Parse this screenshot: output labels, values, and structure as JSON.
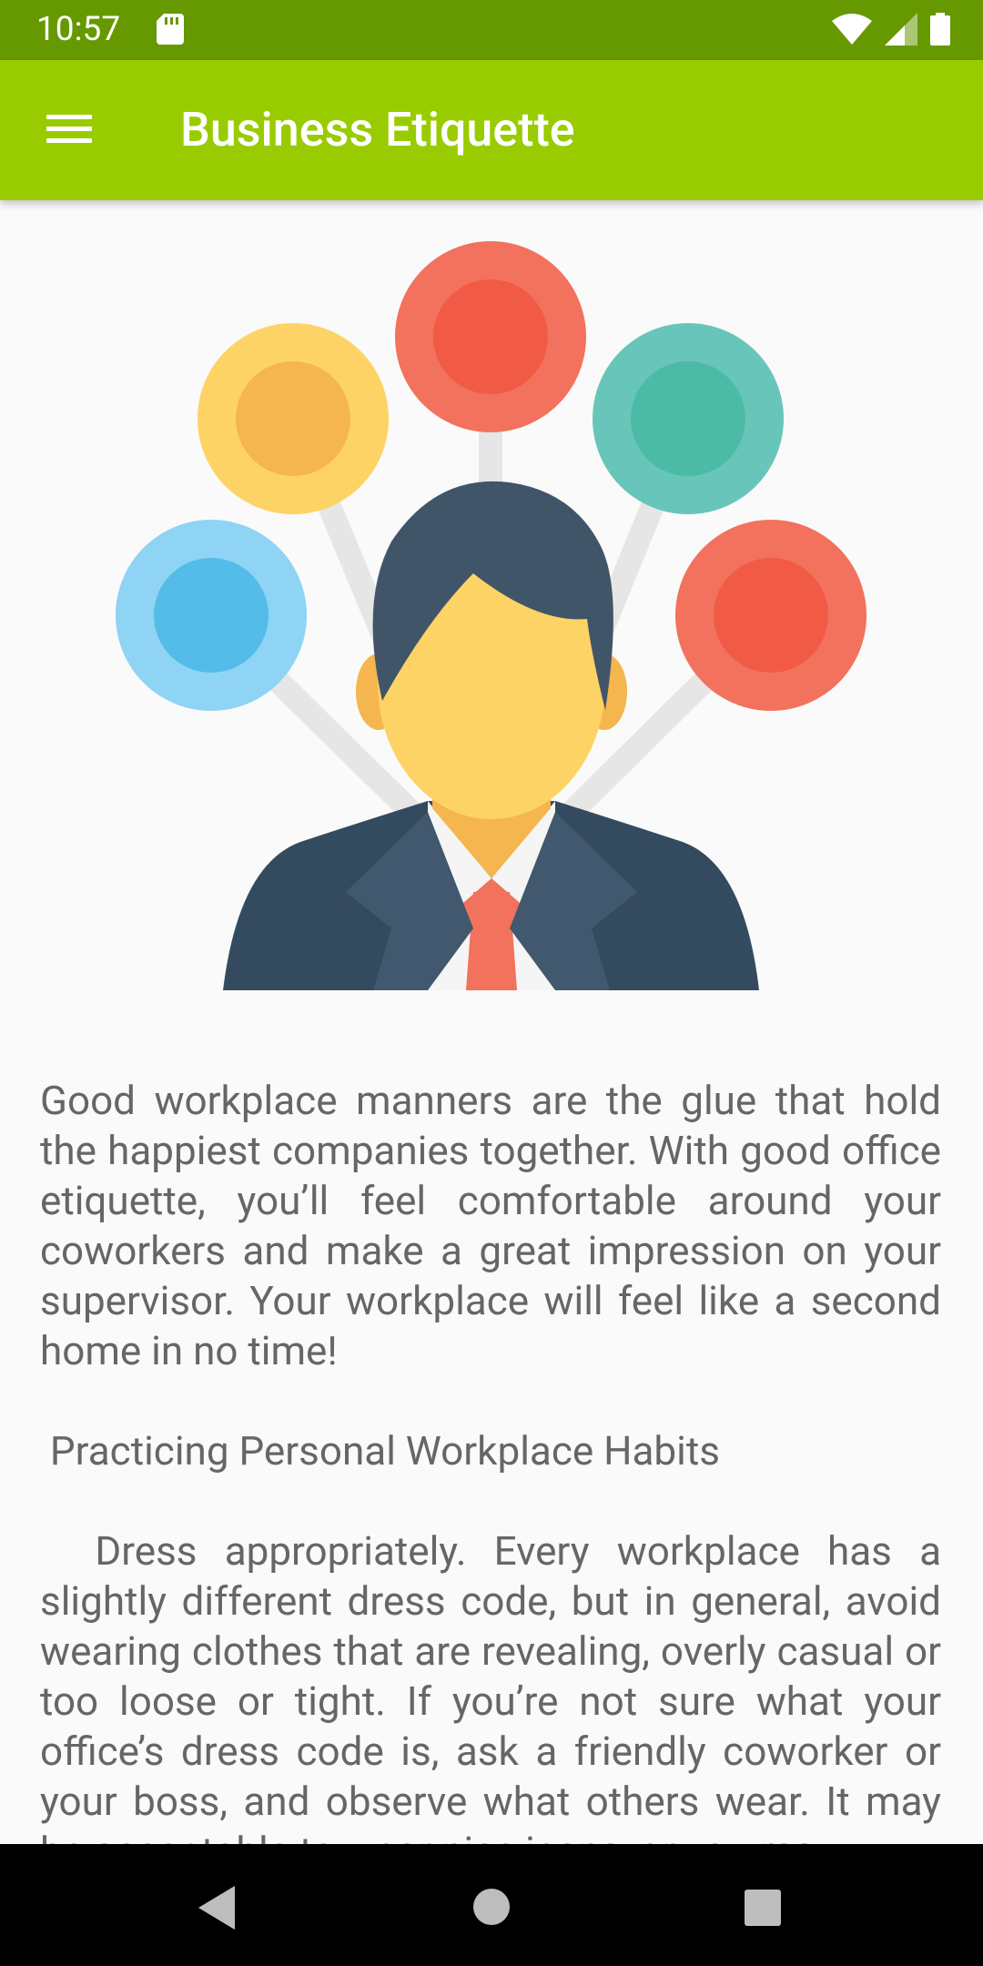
{
  "status_bar": {
    "time": "10:57",
    "icons": [
      "sd-card-icon",
      "wifi-icon",
      "signal-icon",
      "battery-icon"
    ]
  },
  "toolbar": {
    "title": "Business Etiquette",
    "menu_icon": "hamburger-menu-icon",
    "background": "#99cc00"
  },
  "article": {
    "intro": "Good workplace manners are the glue that hold the happiest companies together. With good office etiquette, you’ll feel comfortable around your coworkers and make a great impression on your supervisor. Your workplace will feel like a second home in no time!",
    "heading": " Practicing Personal Workplace Habits",
    "body": "  Dress appropriately. Every workplace has a slightly different dress code, but in general, avoid wearing clothes that are revealing, overly casual or too loose or tight. If you’re not sure what your office’s dress code is, ask a friendly coworker or your boss, and observe what others wear. It may be acceptable to wear nice jeans, or you may"
  },
  "nav_bar": {
    "buttons": [
      "back-icon",
      "home-icon",
      "recents-icon"
    ]
  }
}
